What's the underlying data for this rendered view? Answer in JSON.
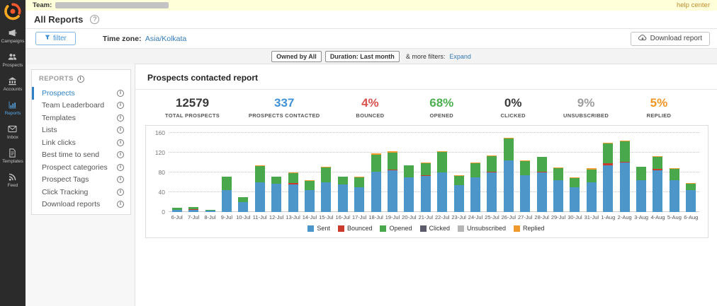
{
  "top_bar": {
    "team_label": "Team:",
    "help_link": "help center"
  },
  "sidebar": {
    "items": [
      {
        "label": "Campaigns",
        "icon": "megaphone-icon",
        "active": false
      },
      {
        "label": "Prospects",
        "icon": "people-icon",
        "active": false
      },
      {
        "label": "Accounts",
        "icon": "building-icon",
        "active": false
      },
      {
        "label": "Reports",
        "icon": "bar-chart-icon",
        "active": true
      },
      {
        "label": "Inbox",
        "icon": "envelope-icon",
        "active": false
      },
      {
        "label": "Templates",
        "icon": "document-icon",
        "active": false
      },
      {
        "label": "Feed",
        "icon": "rss-feed-icon",
        "active": false
      }
    ]
  },
  "header": {
    "title": "All Reports",
    "help_icon": "question-circle-icon"
  },
  "toolbar": {
    "filter_button": "filter",
    "filter_icon": "funnel-icon",
    "timezone_label": "Time zone:",
    "timezone_value": "Asia/Kolkata",
    "download_button": "Download report",
    "download_icon": "cloud-download-icon"
  },
  "filters": {
    "chips": [
      "Owned by All",
      "Duration: Last month"
    ],
    "more_label": "& more filters:",
    "expand_link": "Expand"
  },
  "reports_panel": {
    "title": "REPORTS",
    "items": [
      "Prospects",
      "Team Leaderboard",
      "Templates",
      "Lists",
      "Link clicks",
      "Best time to send",
      "Prospect categories",
      "Prospect Tags",
      "Click Tracking",
      "Download reports"
    ],
    "active_index": 0,
    "item_info_icon": "info-icon"
  },
  "main": {
    "title": "Prospects contacted report",
    "stats": [
      {
        "value": "12579",
        "label": "TOTAL PROSPECTS",
        "color": "#3a3a3a"
      },
      {
        "value": "337",
        "label": "PROSPECTS CONTACTED",
        "color": "#4191d6"
      },
      {
        "value": "4%",
        "label": "BOUNCED",
        "color": "#d9534f"
      },
      {
        "value": "68%",
        "label": "OPENED",
        "color": "#4caf50"
      },
      {
        "value": "0%",
        "label": "CLICKED",
        "color": "#3a3a3a"
      },
      {
        "value": "9%",
        "label": "UNSUBSCRIBED",
        "color": "#9e9e9e"
      },
      {
        "value": "5%",
        "label": "REPLIED",
        "color": "#ef9526"
      }
    ]
  },
  "chart_data": {
    "type": "bar",
    "stacked": true,
    "title": "Prospects contacted report",
    "xlabel": "",
    "ylabel": "",
    "ylim": [
      0,
      160
    ],
    "yticks": [
      0,
      40,
      80,
      120,
      160
    ],
    "grid": "dotted-horizontal",
    "legend_position": "bottom",
    "categories": [
      "6-Jul",
      "7-Jul",
      "8-Jul",
      "9-Jul",
      "10-Jul",
      "11-Jul",
      "12-Jul",
      "13-Jul",
      "14-Jul",
      "15-Jul",
      "16-Jul",
      "17-Jul",
      "18-Jul",
      "19-Jul",
      "20-Jul",
      "21-Jul",
      "22-Jul",
      "23-Jul",
      "24-Jul",
      "25-Jul",
      "26-Jul",
      "27-Jul",
      "28-Jul",
      "29-Jul",
      "30-Jul",
      "31-Jul",
      "1-Aug",
      "2-Aug",
      "3-Aug",
      "4-Aug",
      "5-Aug",
      "6-Aug"
    ],
    "series": [
      {
        "name": "Sent",
        "color": "#4d96c9",
        "values": [
          5,
          5,
          3,
          45,
          20,
          60,
          57,
          56,
          45,
          60,
          56,
          50,
          82,
          85,
          70,
          73,
          80,
          55,
          70,
          80,
          104,
          75,
          80,
          65,
          50,
          60,
          95,
          100,
          65,
          85,
          65,
          45
        ]
      },
      {
        "name": "Bounced",
        "color": "#cc3a2e",
        "values": [
          0,
          1,
          0,
          0,
          0,
          0,
          0,
          2,
          0,
          0,
          0,
          0,
          0,
          1,
          0,
          2,
          0,
          0,
          0,
          2,
          0,
          0,
          1,
          0,
          0,
          0,
          3,
          2,
          0,
          2,
          0,
          0
        ]
      },
      {
        "name": "Opened",
        "color": "#49a84c",
        "values": [
          3,
          4,
          2,
          26,
          10,
          33,
          14,
          20,
          18,
          30,
          15,
          20,
          34,
          34,
          24,
          24,
          41,
          18,
          29,
          31,
          44,
          28,
          30,
          24,
          19,
          26,
          40,
          41,
          26,
          25,
          22,
          12
        ]
      },
      {
        "name": "Clicked",
        "color": "#5b5b6b",
        "values": [
          0,
          0,
          0,
          0,
          0,
          0,
          0,
          0,
          0,
          0,
          0,
          0,
          0,
          0,
          0,
          0,
          0,
          0,
          0,
          0,
          0,
          0,
          0,
          0,
          0,
          0,
          0,
          0,
          0,
          0,
          0,
          0
        ]
      },
      {
        "name": "Unsubscribed",
        "color": "#b5b5b5",
        "values": [
          0,
          0,
          0,
          0,
          0,
          0,
          0,
          0,
          0,
          0,
          0,
          0,
          0,
          0,
          0,
          0,
          0,
          0,
          0,
          0,
          0,
          0,
          0,
          0,
          0,
          0,
          0,
          0,
          0,
          0,
          0,
          0
        ]
      },
      {
        "name": "Replied",
        "color": "#ee9a2d",
        "values": [
          0,
          0,
          0,
          1,
          0,
          2,
          1,
          2,
          1,
          2,
          1,
          2,
          2,
          3,
          1,
          1,
          2,
          1,
          1,
          2,
          2,
          2,
          1,
          1,
          1,
          2,
          2,
          2,
          1,
          1,
          1,
          1
        ]
      }
    ]
  }
}
